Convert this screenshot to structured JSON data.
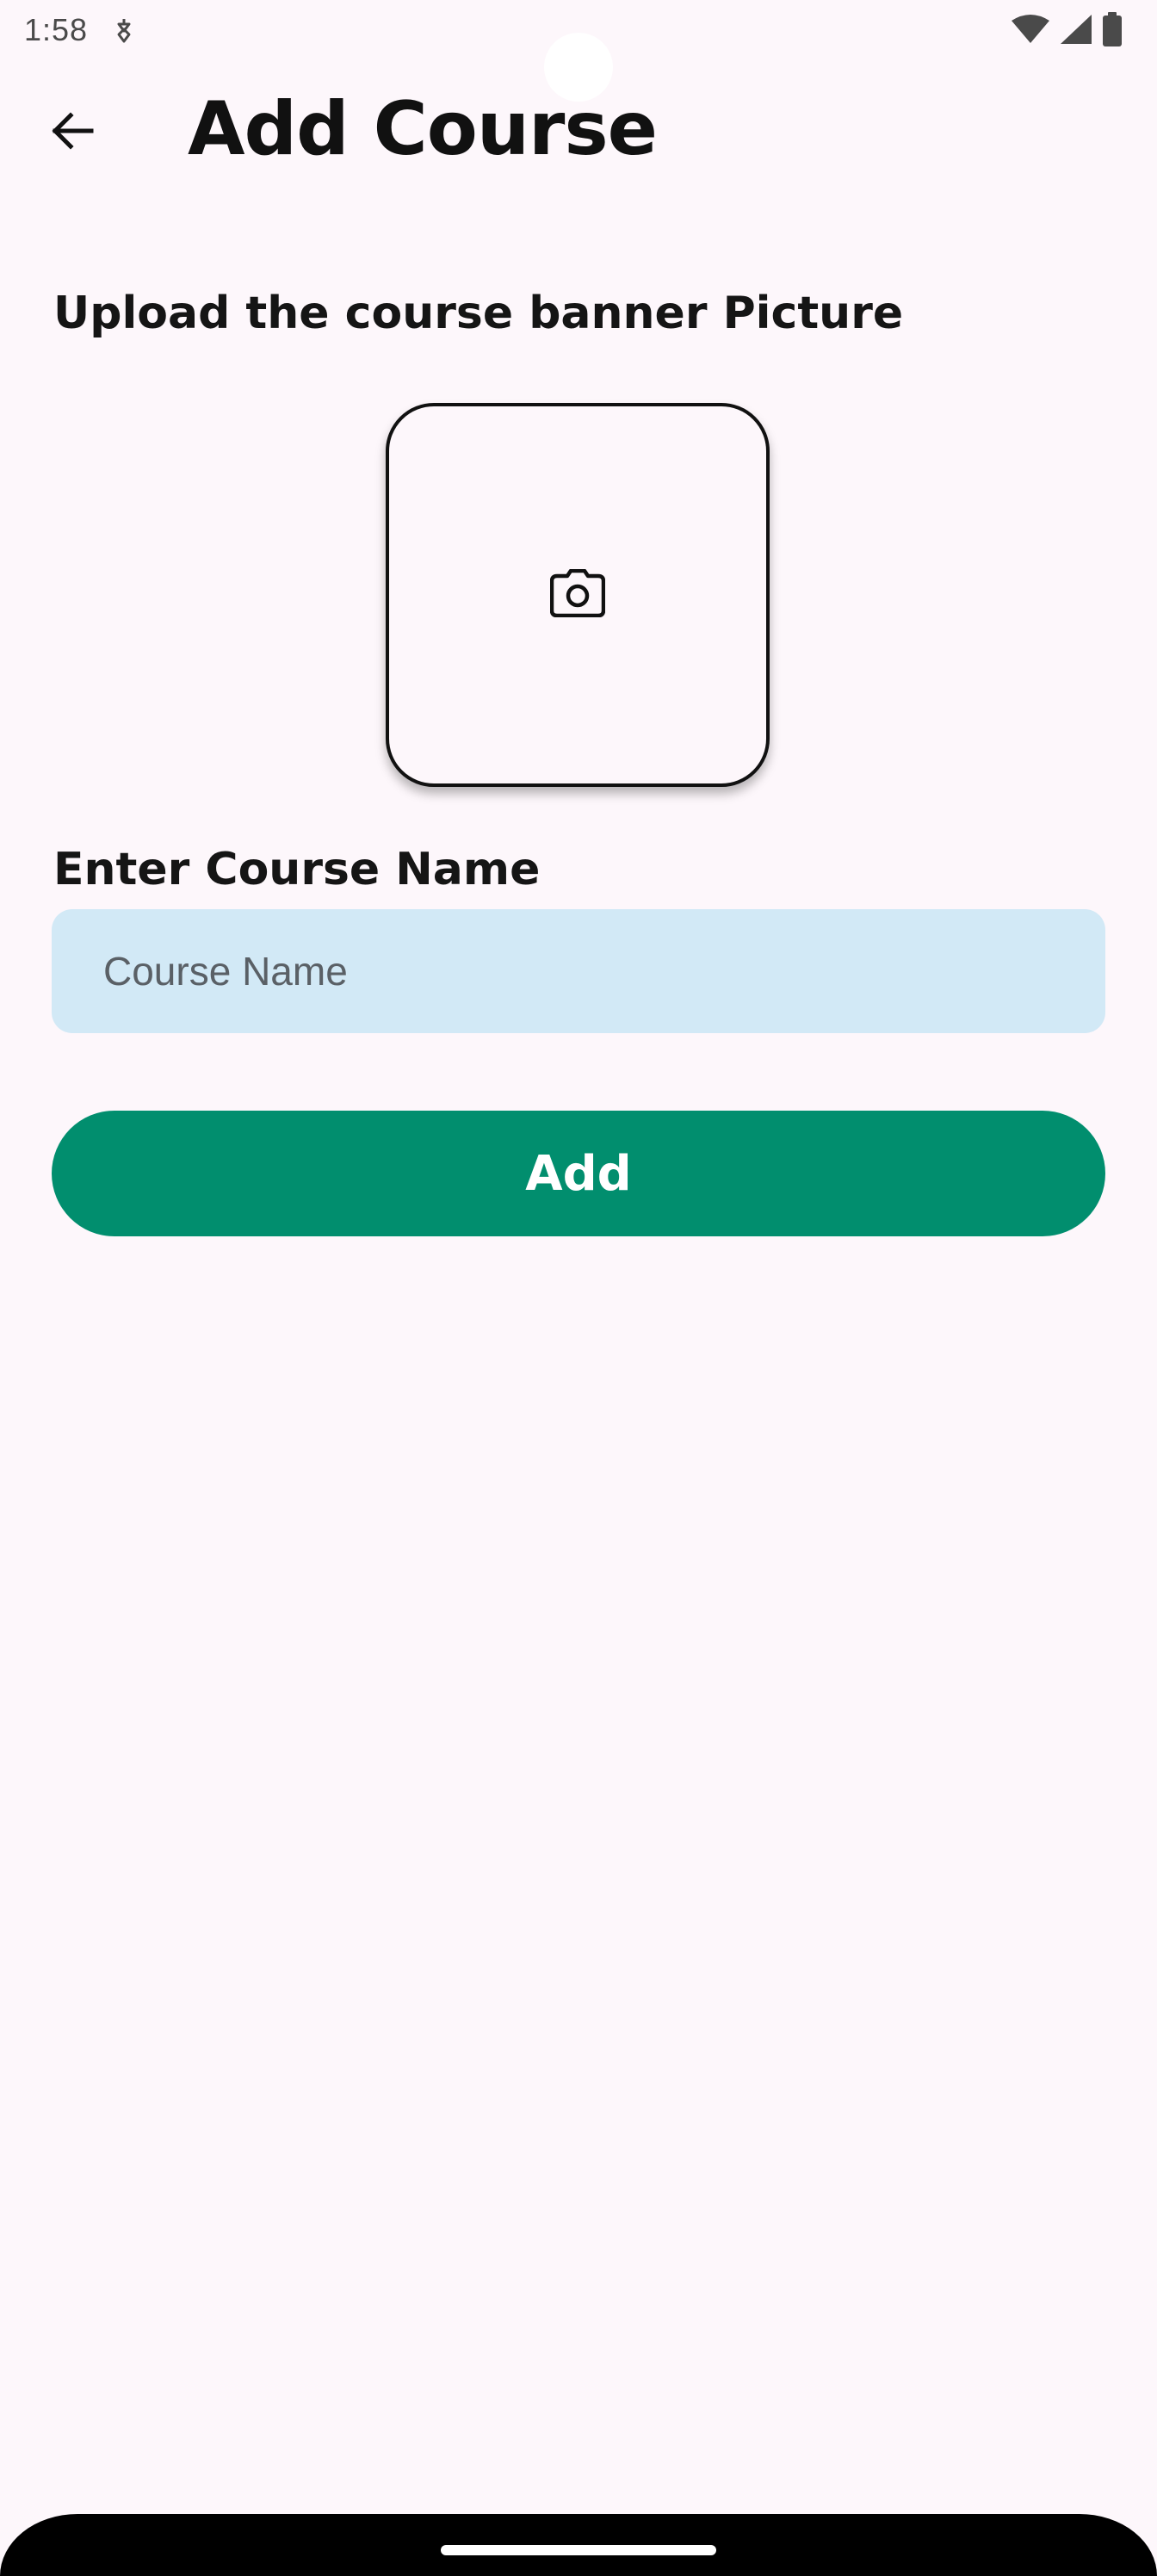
{
  "status_bar": {
    "time": "1:58",
    "icons": [
      "notification-icon",
      "wifi-icon",
      "signal-icon",
      "battery-icon"
    ]
  },
  "app_bar": {
    "back_icon": "arrow-back-icon",
    "title": "Add Course"
  },
  "banner_section": {
    "label": "Upload the course banner Picture",
    "upload_icon": "camera-icon"
  },
  "name_section": {
    "label": "Enter Course Name",
    "input_value": "",
    "input_placeholder": "Course Name"
  },
  "actions": {
    "add_label": "Add"
  },
  "colors": {
    "background": "#fdf7fb",
    "input_fill": "#d2e9f6",
    "primary_button": "#018e6e",
    "text_primary": "#111111"
  }
}
